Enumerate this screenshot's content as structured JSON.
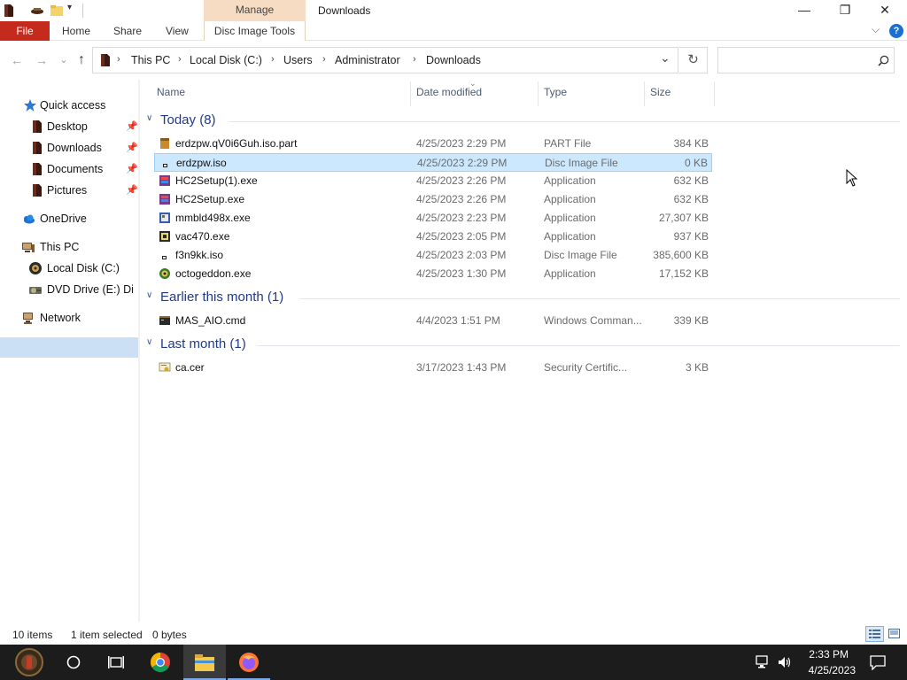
{
  "titlebar": {
    "manage_tab": "Manage",
    "title": "Downloads",
    "minimize_glyph": "—",
    "maximize_glyph": "❐",
    "close_glyph": "✕"
  },
  "ribbon": {
    "file": "File",
    "home": "Home",
    "share": "Share",
    "view": "View",
    "disc_image_tools": "Disc Image Tools",
    "expand_glyph": "⌵",
    "help_glyph": "?"
  },
  "address": {
    "crumbs": [
      "This PC",
      "Local Disk (C:)",
      "Users",
      "Administrator",
      "Downloads"
    ],
    "separator": "›",
    "dropdown_glyph": "⌄",
    "refresh_glyph": "↻",
    "search_placeholder": "",
    "back_glyph": "←",
    "forward_glyph": "→",
    "recent_glyph": "⌄",
    "up_glyph": "↑"
  },
  "nav": {
    "quick_access": "Quick access",
    "desktop": "Desktop",
    "downloads": "Downloads",
    "documents": "Documents",
    "pictures": "Pictures",
    "onedrive": "OneDrive",
    "this_pc": "This PC",
    "local_disk": "Local Disk (C:)",
    "dvd_drive": "DVD Drive (E:) Di",
    "network": "Network",
    "pin_glyph": "📌"
  },
  "columns": {
    "name": "Name",
    "date_modified": "Date modified",
    "type": "Type",
    "size": "Size"
  },
  "groups": [
    {
      "label": "Today (8)",
      "files": [
        {
          "name": "erdzpw.qV0i6Guh.iso.part",
          "date": "4/25/2023 2:29 PM",
          "type": "PART File",
          "size": "384 KB",
          "icon": "part-file-icon",
          "selected": false
        },
        {
          "name": "erdzpw.iso",
          "date": "4/25/2023 2:29 PM",
          "type": "Disc Image File",
          "size": "0 KB",
          "icon": "disc-image-icon",
          "selected": true
        },
        {
          "name": "HC2Setup(1).exe",
          "date": "4/25/2023 2:26 PM",
          "type": "Application",
          "size": "632 KB",
          "icon": "installer-icon",
          "selected": false
        },
        {
          "name": "HC2Setup.exe",
          "date": "4/25/2023 2:26 PM",
          "type": "Application",
          "size": "632 KB",
          "icon": "installer-icon",
          "selected": false
        },
        {
          "name": "mmbld498x.exe",
          "date": "4/25/2023 2:23 PM",
          "type": "Application",
          "size": "27,307 KB",
          "icon": "app-icon",
          "selected": false
        },
        {
          "name": "vac470.exe",
          "date": "4/25/2023 2:05 PM",
          "type": "Application",
          "size": "937 KB",
          "icon": "app-icon",
          "selected": false
        },
        {
          "name": "f3n9kk.iso",
          "date": "4/25/2023 2:03 PM",
          "type": "Disc Image File",
          "size": "385,600 KB",
          "icon": "disc-image-icon",
          "selected": false
        },
        {
          "name": "octogeddon.exe",
          "date": "4/25/2023 1:30 PM",
          "type": "Application",
          "size": "17,152 KB",
          "icon": "game-icon",
          "selected": false
        }
      ]
    },
    {
      "label": "Earlier this month (1)",
      "files": [
        {
          "name": "MAS_AIO.cmd",
          "date": "4/4/2023 1:51 PM",
          "type": "Windows Comman...",
          "size": "339 KB",
          "icon": "cmd-file-icon",
          "selected": false
        }
      ]
    },
    {
      "label": "Last month (1)",
      "files": [
        {
          "name": "ca.cer",
          "date": "3/17/2023 1:43 PM",
          "type": "Security Certific...",
          "size": "3 KB",
          "icon": "certificate-icon",
          "selected": false
        }
      ]
    }
  ],
  "status": {
    "items": "10 items",
    "selected": "1 item selected",
    "bytes": "0 bytes"
  },
  "taskbar": {
    "time": "2:33 PM",
    "date": "4/25/2023"
  },
  "colors": {
    "file_tab": "#c42b1c",
    "manage_tab": "#f7dcc4",
    "selection": "#cce8ff",
    "group_header": "#1e3a8a",
    "taskbar": "#1c1c1c"
  }
}
